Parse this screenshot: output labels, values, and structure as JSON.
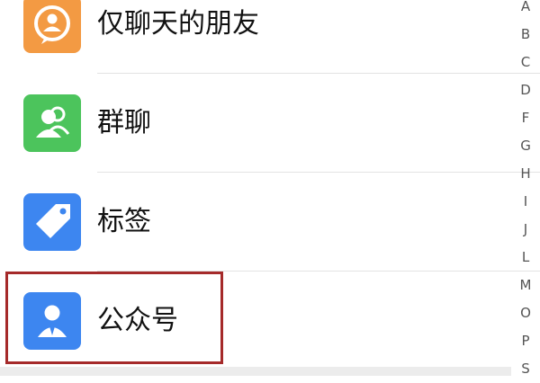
{
  "contacts": {
    "items": [
      {
        "label": "仅聊天的朋友",
        "icon": "chat-only-friends-icon",
        "color": "#f39a43"
      },
      {
        "label": "群聊",
        "icon": "group-chat-icon",
        "color": "#4cc45c"
      },
      {
        "label": "标签",
        "icon": "tag-icon",
        "color": "#3d86f0"
      },
      {
        "label": "公众号",
        "icon": "official-account-icon",
        "color": "#3d86f0"
      }
    ]
  },
  "highlight_color": "#a52a2a",
  "alphabet_index": [
    "A",
    "B",
    "C",
    "D",
    "F",
    "G",
    "H",
    "I",
    "J",
    "L",
    "M",
    "O",
    "P",
    "S"
  ]
}
